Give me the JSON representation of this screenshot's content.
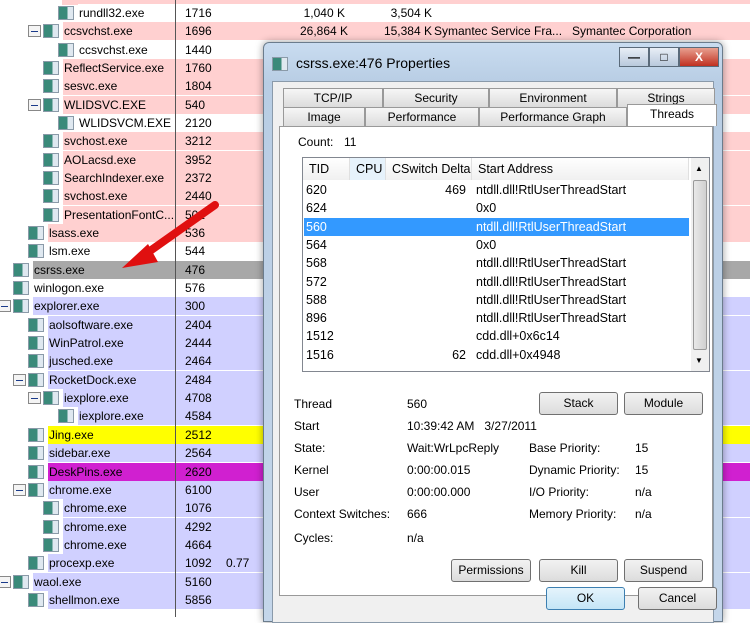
{
  "processes": [
    {
      "name": "rundll32.exe",
      "pid": "1716",
      "level": 3,
      "bg": "#ffffff",
      "private": "1,040 K",
      "working": "3,504 K"
    },
    {
      "name": "ccsvchst.exe",
      "pid": "1696",
      "level": 2,
      "toggle": true,
      "bg": "#ffd0d0",
      "private": "26,864 K",
      "working": "15,384 K",
      "description": "Symantec Service Fra...",
      "company": "Symantec Corporation"
    },
    {
      "name": "ccsvchst.exe",
      "pid": "1440",
      "level": 3,
      "bg": "#ffffff"
    },
    {
      "name": "ReflectService.exe",
      "pid": "1760",
      "level": 2,
      "bg": "#ffd0d0"
    },
    {
      "name": "sesvc.exe",
      "pid": "1804",
      "level": 2,
      "bg": "#ffd0d0"
    },
    {
      "name": "WLIDSVC.EXE",
      "pid": "540",
      "level": 2,
      "toggle": true,
      "bg": "#ffd0d0"
    },
    {
      "name": "WLIDSVCM.EXE",
      "pid": "2120",
      "level": 3,
      "bg": "#ffffff"
    },
    {
      "name": "svchost.exe",
      "pid": "3212",
      "level": 2,
      "bg": "#ffd0d0"
    },
    {
      "name": "AOLacsd.exe",
      "pid": "3952",
      "level": 2,
      "bg": "#ffd0d0"
    },
    {
      "name": "SearchIndexer.exe",
      "pid": "2372",
      "level": 2,
      "bg": "#ffd0d0"
    },
    {
      "name": "svchost.exe",
      "pid": "2440",
      "level": 2,
      "bg": "#ffd0d0"
    },
    {
      "name": "PresentationFontC...",
      "pid": "502",
      "level": 2,
      "bg": "#ffd0d0"
    },
    {
      "name": "lsass.exe",
      "pid": "536",
      "level": 1,
      "bg": "#ffd0d0"
    },
    {
      "name": "lsm.exe",
      "pid": "544",
      "level": 1,
      "bg": "#ffffff"
    },
    {
      "name": "csrss.exe",
      "pid": "476",
      "level": 0,
      "bg": "#a8a8a8"
    },
    {
      "name": "winlogon.exe",
      "pid": "576",
      "level": 0,
      "bg": "#ffffff"
    },
    {
      "name": "explorer.exe",
      "pid": "300",
      "level": 0,
      "toggle": true,
      "bg": "#d0d0ff"
    },
    {
      "name": "aolsoftware.exe",
      "pid": "2404",
      "level": 1,
      "bg": "#d0d0ff"
    },
    {
      "name": "WinPatrol.exe",
      "pid": "2444",
      "level": 1,
      "bg": "#d0d0ff"
    },
    {
      "name": "jusched.exe",
      "pid": "2464",
      "level": 1,
      "bg": "#d0d0ff"
    },
    {
      "name": "RocketDock.exe",
      "pid": "2484",
      "level": 1,
      "toggle": true,
      "bg": "#d0d0ff"
    },
    {
      "name": "iexplore.exe",
      "pid": "4708",
      "level": 2,
      "toggle": true,
      "bg": "#d0d0ff"
    },
    {
      "name": "iexplore.exe",
      "pid": "4584",
      "level": 3,
      "bg": "#d0d0ff"
    },
    {
      "name": "Jing.exe",
      "pid": "2512",
      "level": 1,
      "bg": "#ffff00"
    },
    {
      "name": "sidebar.exe",
      "pid": "2564",
      "level": 1,
      "bg": "#d0d0ff"
    },
    {
      "name": "DeskPins.exe",
      "pid": "2620",
      "level": 1,
      "bg": "#d020d0"
    },
    {
      "name": "chrome.exe",
      "pid": "6100",
      "level": 1,
      "toggle": true,
      "bg": "#d0d0ff"
    },
    {
      "name": "chrome.exe",
      "pid": "1076",
      "level": 2,
      "bg": "#d0d0ff"
    },
    {
      "name": "chrome.exe",
      "pid": "4292",
      "level": 2,
      "bg": "#d0d0ff"
    },
    {
      "name": "chrome.exe",
      "pid": "4664",
      "level": 2,
      "bg": "#d0d0ff"
    },
    {
      "name": "procexp.exe",
      "pid": "1092",
      "level": 1,
      "bg": "#d0d0ff",
      "cpu": "0.77"
    },
    {
      "name": "waol.exe",
      "pid": "5160",
      "level": 0,
      "toggle": true,
      "bg": "#d0d0ff"
    },
    {
      "name": "shellmon.exe",
      "pid": "5856",
      "level": 1,
      "bg": "#d0d0ff"
    }
  ],
  "dialog": {
    "title": "csrss.exe:476 Properties",
    "tabs_row1": [
      "TCP/IP",
      "Security",
      "Environment",
      "Strings"
    ],
    "tabs_row2": [
      "Image",
      "Performance",
      "Performance Graph",
      "Threads"
    ],
    "active_tab": "Threads",
    "count_label": "Count:",
    "count": "11",
    "columns": [
      "TID",
      "CPU",
      "CSwitch Delta",
      "Start Address"
    ],
    "threads": [
      {
        "tid": "620",
        "cswitch": "469",
        "start": "ntdll.dll!RtlUserThreadStart"
      },
      {
        "tid": "624",
        "cswitch": "",
        "start": "0x0"
      },
      {
        "tid": "560",
        "cswitch": "",
        "start": "ntdll.dll!RtlUserThreadStart",
        "selected": true
      },
      {
        "tid": "564",
        "cswitch": "",
        "start": "0x0"
      },
      {
        "tid": "568",
        "cswitch": "",
        "start": "ntdll.dll!RtlUserThreadStart"
      },
      {
        "tid": "572",
        "cswitch": "",
        "start": "ntdll.dll!RtlUserThreadStart"
      },
      {
        "tid": "588",
        "cswitch": "",
        "start": "ntdll.dll!RtlUserThreadStart"
      },
      {
        "tid": "896",
        "cswitch": "",
        "start": "ntdll.dll!RtlUserThreadStart"
      },
      {
        "tid": "1512",
        "cswitch": "",
        "start": "cdd.dll+0x6c14"
      },
      {
        "tid": "1516",
        "cswitch": "62",
        "start": "cdd.dll+0x4948"
      }
    ],
    "details": {
      "thread_label": "Thread",
      "thread": "560",
      "start_label": "Start",
      "start": "10:39:42 AM   3/27/2011",
      "state_label": "State:",
      "state": "Wait:WrLpcReply",
      "kernel_label": "Kernel",
      "kernel": "0:00:00.015",
      "user_label": "User",
      "user": "0:00:00.000",
      "cs_label": "Context Switches:",
      "cs": "666",
      "cycles_label": "Cycles:",
      "cycles": "n/a",
      "base_label": "Base Priority:",
      "base": "15",
      "dyn_label": "Dynamic Priority:",
      "dyn": "15",
      "io_label": "I/O Priority:",
      "io": "n/a",
      "mem_label": "Memory Priority:",
      "mem": "n/a"
    },
    "buttons": {
      "stack": "Stack",
      "module": "Module",
      "permissions": "Permissions",
      "kill": "Kill",
      "suspend": "Suspend",
      "ok": "OK",
      "cancel": "Cancel"
    },
    "window_buttons": {
      "minimize": "—",
      "maximize": "□",
      "close": "X"
    }
  },
  "colors": {
    "arrow": "#e01010",
    "selection": "#3399ff"
  }
}
